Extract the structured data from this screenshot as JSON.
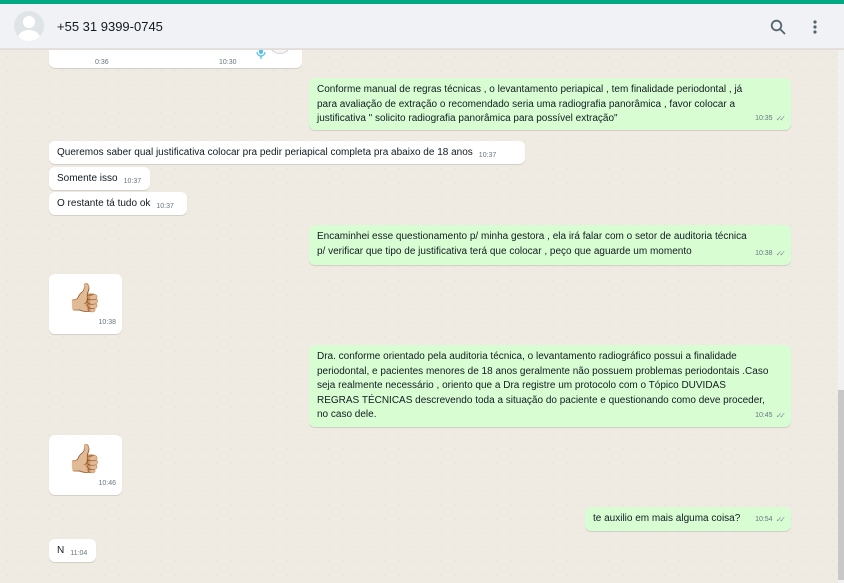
{
  "header": {
    "contact": "+55 31 9399-0745",
    "icons": [
      "search-icon",
      "menu-icon"
    ]
  },
  "colors": {
    "accent": "#00a884",
    "outgoing": "#d9fdd3",
    "incoming": "#ffffff",
    "chat_bg": "#efeae2"
  },
  "audio": {
    "duration": "0:36",
    "time": "10:30"
  },
  "messages": [
    {
      "dir": "out",
      "text": "Conforme manual de regras técnicas , o levantamento periapical , tem finalidade periodontal , já para avaliação de extração  o recomendado seria uma radiografia panorâmica , favor colocar a justificativa  \" solicito radiografia panorâmica para possível extração\"",
      "time": "10:35"
    },
    {
      "dir": "in",
      "text": "Queremos saber qual justificativa colocar pra pedir periapical completa pra abaixo de 18 anos",
      "time": "10:37"
    },
    {
      "dir": "in",
      "text": "Somente isso",
      "time": "10:37"
    },
    {
      "dir": "in",
      "text": "O restante tá tudo ok",
      "time": "10:37"
    },
    {
      "dir": "out",
      "text": "Encaminhei esse questionamento p/ minha gestora , ela irá falar com o setor de auditoria técnica p/ verificar que tipo de justificativa terá que colocar , peço que aguarde um momento",
      "time": "10:38"
    },
    {
      "dir": "in",
      "text": "👍🏼",
      "time": "10:38"
    },
    {
      "dir": "out",
      "text": "Dra. conforme orientado pela auditoria técnica, o levantamento radiográfico possui a finalidade periodontal, e pacientes menores de 18 anos geralmente não possuem problemas periodontais .Caso seja realmente necessário , oriento que a Dra registre um protocolo com o Tópico DUVIDAS REGRAS TÉCNICAS descrevendo toda a situação do paciente e questionando como deve proceder, no caso dele.",
      "time": "10:45"
    },
    {
      "dir": "in",
      "text": "👍🏼",
      "time": "10:46"
    },
    {
      "dir": "out",
      "text": "te auxilio em mais alguma coisa?",
      "time": "10:54"
    },
    {
      "dir": "in",
      "text": "N",
      "time": "11:04"
    }
  ]
}
